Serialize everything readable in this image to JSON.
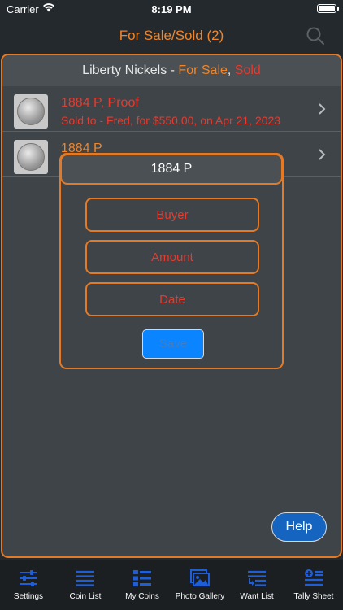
{
  "status_bar": {
    "carrier": "Carrier",
    "time": "8:19 PM"
  },
  "nav": {
    "title": "For Sale/Sold (2)"
  },
  "list_header": {
    "prefix": "Liberty Nickels - ",
    "for_sale": "For Sale",
    "separator": ", ",
    "sold": "Sold"
  },
  "rows": [
    {
      "title": "1884 P, Proof",
      "subtitle": "Sold to - Fred, for $550.00, on Apr 21, 2023",
      "title_color": "#e83a2e"
    },
    {
      "title": "1884 P",
      "subtitle": "",
      "title_color": "#f0852a"
    }
  ],
  "modal": {
    "title": "1884 P",
    "buyer_placeholder": "Buyer",
    "amount_placeholder": "Amount",
    "date_placeholder": "Date",
    "save_label": "Save"
  },
  "help_label": "Help",
  "tabs": [
    {
      "label": "Settings",
      "icon": "sliders-icon"
    },
    {
      "label": "Coin List",
      "icon": "list-icon"
    },
    {
      "label": "My Coins",
      "icon": "grid-list-icon"
    },
    {
      "label": "Photo Gallery",
      "icon": "photos-icon"
    },
    {
      "label": "Want List",
      "icon": "want-list-icon"
    },
    {
      "label": "Tally Sheet",
      "icon": "tally-icon"
    }
  ],
  "colors": {
    "accent_orange": "#f0852a",
    "sold_red": "#e83a2e",
    "icon_blue": "#1e5fd8",
    "save_blue": "#0a84ff"
  }
}
